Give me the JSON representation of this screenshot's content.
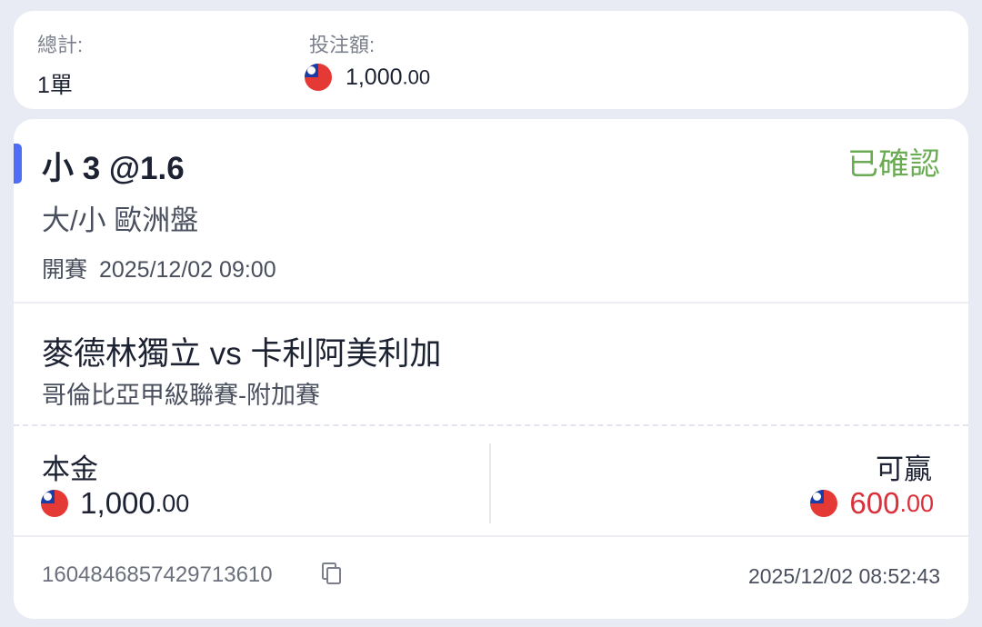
{
  "summary": {
    "total_label": "總計:",
    "total_value": "1單",
    "stake_label": "投注額:",
    "stake_int": "1,000",
    "stake_dec": ".00",
    "currency_icon": "taiwan-flag-icon"
  },
  "bet": {
    "selection": "小 3 @1.6",
    "status": "已確認",
    "status_color": "#6bab54",
    "market": "大/小 歐洲盤",
    "kickoff_label": "開賽",
    "kickoff_time": "2025/12/02 09:00",
    "match": "麥德林獨立 vs 卡利阿美利加",
    "league": "哥倫比亞甲級聯賽-附加賽",
    "principal_label": "本金",
    "principal_int": "1,000",
    "principal_dec": ".00",
    "win_label": "可贏",
    "win_int": "600",
    "win_dec": ".00",
    "win_color": "#d9303a",
    "bet_id": "1604846857429713610",
    "placed_time": "2025/12/02 08:52:43",
    "accent_color": "#4f6ef5"
  }
}
